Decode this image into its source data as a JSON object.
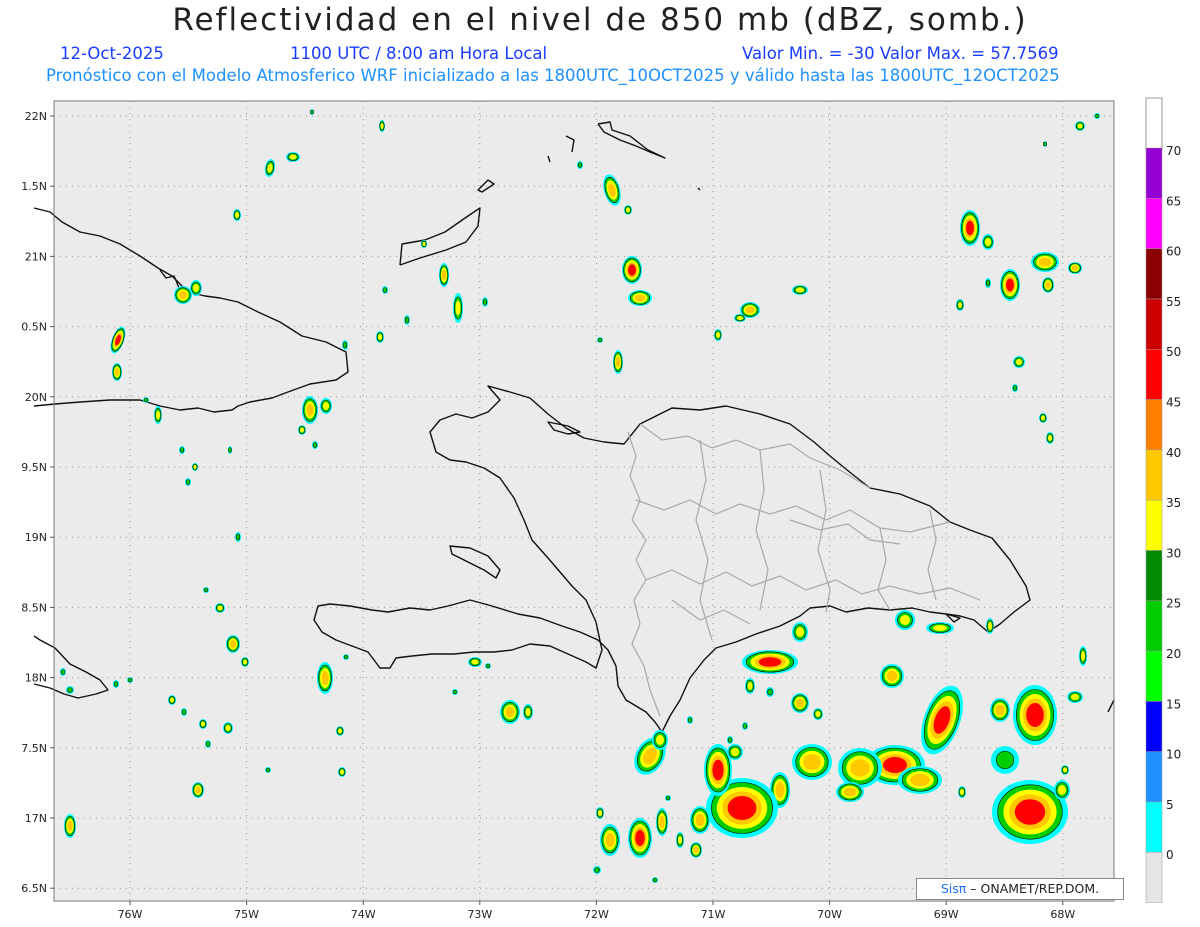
{
  "header": {
    "title": "Reflectividad en el nivel de 850 mb (dBZ, somb.)",
    "date": "12-Oct-2025",
    "time": "1100 UTC / 8:00 am Hora Local",
    "minmax": "Valor Min. = -30  Valor Max. = 57.7569",
    "forecast": "Pronóstico con el Modelo Atmosferico WRF inicializado a las 1800UTC_10OCT2025 y válido hasta las  1800UTC_12OCT2025"
  },
  "map": {
    "lat_ticks": [
      "22N",
      "1.5N",
      "21N",
      "0.5N",
      "20N",
      "9.5N",
      "19N",
      "8.5N",
      "18N",
      "7.5N",
      "17N",
      "6.5N"
    ],
    "lon_ticks": [
      "76W",
      "75W",
      "74W",
      "73W",
      "72W",
      "71W",
      "70W",
      "69W",
      "68W"
    ],
    "lat_range": [
      16.5,
      22.0
    ],
    "lon_range": [
      -76.65,
      -67.6
    ],
    "grid": true,
    "background": "#ebebeb"
  },
  "colorbar": {
    "labels": [
      "0",
      "5",
      "10",
      "15",
      "20",
      "25",
      "30",
      "35",
      "40",
      "45",
      "50",
      "55",
      "60",
      "65",
      "70"
    ],
    "colors": [
      "#e6e6e6",
      "#00ffff",
      "#1e90ff",
      "#0000ff",
      "#00ff00",
      "#00cd00",
      "#008b00",
      "#ffff00",
      "#ffc800",
      "#ff8000",
      "#ff0000",
      "#cd0000",
      "#8b0000",
      "#ff00ff",
      "#9400d3"
    ]
  },
  "credit": {
    "logo": "Sisπ",
    "text": "– ONAMET/REP.DOM."
  }
}
